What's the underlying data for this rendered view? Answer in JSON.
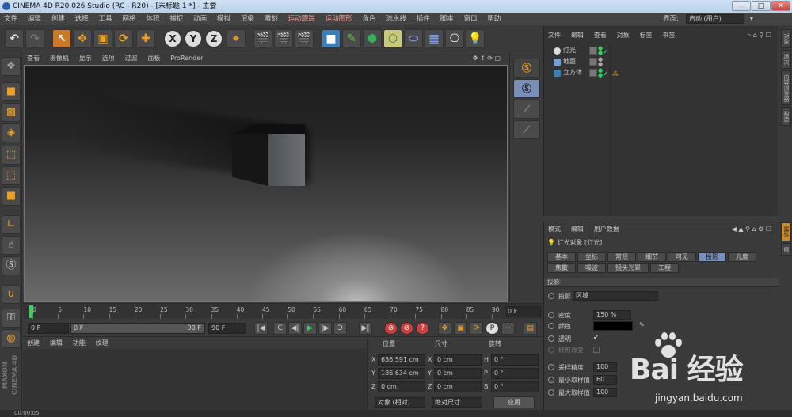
{
  "title_bar": {
    "title": "CINEMA 4D R20.026 Studio (RC - R20) - [未标题 1 *] - 主要",
    "min": "—",
    "max": "□",
    "close": "✕"
  },
  "menu": {
    "items": [
      "文件",
      "编辑",
      "创建",
      "选择",
      "工具",
      "网格",
      "体积",
      "捕捉",
      "动画",
      "模拟",
      "渲染",
      "雕刻",
      "运动跟踪",
      "运动图形",
      "角色",
      "流水线",
      "插件",
      "脚本",
      "窗口",
      "帮助"
    ],
    "layout_label": "界面:",
    "layout_value": "启动 (用户)"
  },
  "toolbar": {
    "undo": "↶",
    "redo": "↷",
    "select": "↖",
    "move": "✥",
    "scale": "▣",
    "rotate": "⟳",
    "add": "✚",
    "x": "X",
    "y": "Y",
    "z": "Z",
    "coord": "⌖"
  },
  "viewport": {
    "menu": [
      "查看",
      "摄像机",
      "显示",
      "选项",
      "过滤",
      "面板",
      "ProRender"
    ]
  },
  "timeline": {
    "ticks": [
      "0",
      "5",
      "10",
      "15",
      "20",
      "25",
      "30",
      "35",
      "40",
      "45",
      "50",
      "55",
      "60",
      "65",
      "70",
      "75",
      "80",
      "85",
      "90"
    ],
    "end_field": "0 F"
  },
  "transport": {
    "start": "0 F",
    "range_start": "0 F",
    "range_end": "90 F",
    "end": "90 F"
  },
  "materials": {
    "menu": [
      "创建",
      "编辑",
      "功能",
      "纹理"
    ]
  },
  "coords": {
    "headers": [
      "位置",
      "尺寸",
      "旋转"
    ],
    "rows": [
      {
        "axis": "X",
        "pos": "636.591 cm",
        "size_axis": "X",
        "size": "0 cm",
        "rot_axis": "H",
        "rot": "0 °"
      },
      {
        "axis": "Y",
        "pos": "186.634 cm",
        "size_axis": "Y",
        "size": "0 cm",
        "rot_axis": "P",
        "rot": "0 °"
      },
      {
        "axis": "Z",
        "pos": "0 cm",
        "size_axis": "Z",
        "size": "0 cm",
        "rot_axis": "B",
        "rot": "0 °"
      }
    ],
    "mode_object": "对象 (相对)",
    "mode_size": "绝对尺寸",
    "apply": "应用"
  },
  "status": {
    "time": "00:00:05"
  },
  "object_manager": {
    "menu": [
      "文件",
      "编辑",
      "查看",
      "对象",
      "标签",
      "书签"
    ],
    "objects": [
      {
        "name": "灯光",
        "color": "#d8d8d8"
      },
      {
        "name": "地面",
        "color": "#6fa0d8"
      },
      {
        "name": "立方体",
        "color": "#3c7fb8"
      }
    ]
  },
  "right_tabs": [
    "对象",
    "场次",
    "内容浏览器",
    "构造"
  ],
  "right_tabs_lower": [
    "属性",
    "层"
  ],
  "attribute_manager": {
    "menu": [
      "模式",
      "编辑",
      "用户数据"
    ],
    "title": "灯光对象 [灯光]",
    "tabs_row1": [
      "基本",
      "坐标",
      "常规",
      "细节",
      "可见",
      "投影",
      "光度"
    ],
    "tabs_row2": [
      "焦散",
      "噪波",
      "镜头光晕",
      "工程"
    ],
    "section": "投影",
    "shadow_label": "投影",
    "shadow_value": "区域",
    "density_label": "密度",
    "density_value": "150 %",
    "color_label": "颜色",
    "transparent_label": "透明",
    "clip_label": "修剪改变",
    "sample_label": "采样精度",
    "sample_value": "100",
    "min_label": "最小取样值",
    "min_value": "60",
    "max_label": "最大取样值",
    "max_value": "100",
    "shadow_color": "#000000",
    "accent": "#7a8fb8"
  },
  "watermark": {
    "brand": "Bai 经验",
    "url": "jingyan.baidu.com"
  }
}
